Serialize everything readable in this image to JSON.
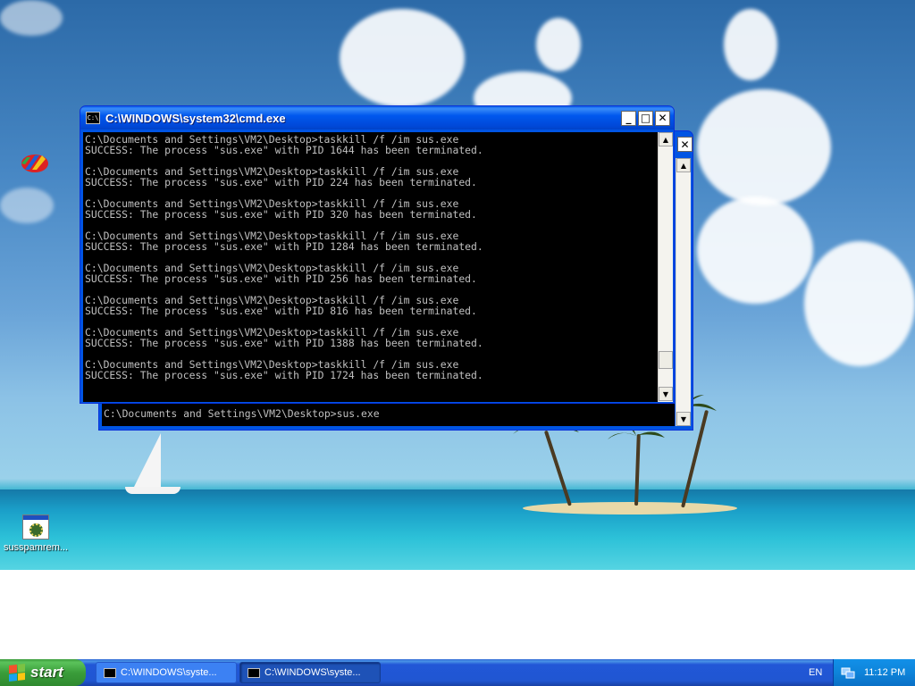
{
  "desktop": {
    "icons": [
      {
        "label": ""
      },
      {
        "label": "susspamrem..."
      }
    ]
  },
  "back_window": {
    "close_symbol": "✕",
    "prompt_line": "C:\\Documents and Settings\\VM2\\Desktop>sus.exe"
  },
  "front_window": {
    "title": "C:\\WINDOWS\\system32\\cmd.exe",
    "icon_text": "C:\\",
    "console_lines": [
      "C:\\Documents and Settings\\VM2\\Desktop>taskkill /f /im sus.exe",
      "SUCCESS: The process \"sus.exe\" with PID 1644 has been terminated.",
      "",
      "C:\\Documents and Settings\\VM2\\Desktop>taskkill /f /im sus.exe",
      "SUCCESS: The process \"sus.exe\" with PID 224 has been terminated.",
      "",
      "C:\\Documents and Settings\\VM2\\Desktop>taskkill /f /im sus.exe",
      "SUCCESS: The process \"sus.exe\" with PID 320 has been terminated.",
      "",
      "C:\\Documents and Settings\\VM2\\Desktop>taskkill /f /im sus.exe",
      "SUCCESS: The process \"sus.exe\" with PID 1284 has been terminated.",
      "",
      "C:\\Documents and Settings\\VM2\\Desktop>taskkill /f /im sus.exe",
      "SUCCESS: The process \"sus.exe\" with PID 256 has been terminated.",
      "",
      "C:\\Documents and Settings\\VM2\\Desktop>taskkill /f /im sus.exe",
      "SUCCESS: The process \"sus.exe\" with PID 816 has been terminated.",
      "",
      "C:\\Documents and Settings\\VM2\\Desktop>taskkill /f /im sus.exe",
      "SUCCESS: The process \"sus.exe\" with PID 1388 has been terminated.",
      "",
      "C:\\Documents and Settings\\VM2\\Desktop>taskkill /f /im sus.exe",
      "SUCCESS: The process \"sus.exe\" with PID 1724 has been terminated."
    ],
    "buttons": {
      "minimize": "_",
      "maximize": "□",
      "close": "✕"
    },
    "scroll_position": 0.92
  },
  "taskbar": {
    "start_label": "start",
    "tasks": [
      {
        "label": "C:\\WINDOWS\\syste...",
        "active": false
      },
      {
        "label": "C:\\WINDOWS\\syste...",
        "active": true
      }
    ],
    "language": "EN",
    "clock": "11:12 PM"
  },
  "colors": {
    "console_bg": "#000000",
    "console_text": "#c0c0c0",
    "titlebar": "#0054e3",
    "taskbar": "#245edb",
    "start_button": "#3c9c3c"
  },
  "icons": {
    "window_icon": "cmd-icon",
    "start_icon": "windows-flag-icon",
    "tray_icon": "network-icon"
  }
}
